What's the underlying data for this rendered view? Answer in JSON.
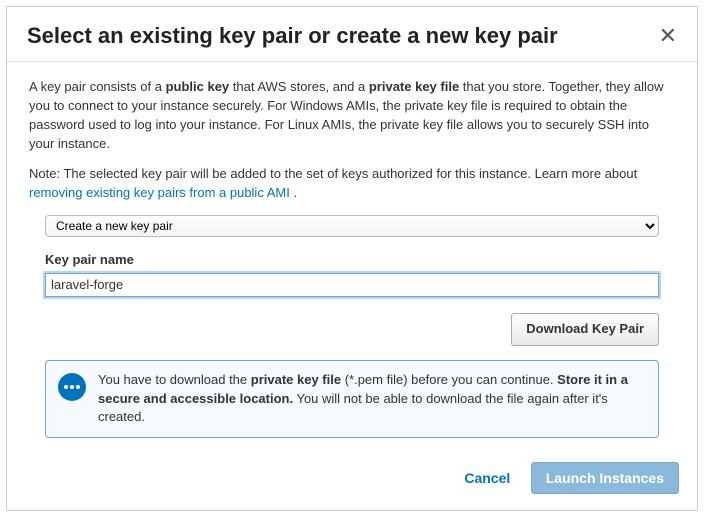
{
  "title": "Select an existing key pair or create a new key pair",
  "desc": {
    "p1a": "A key pair consists of a ",
    "p1b": "public key",
    "p1c": " that AWS stores, and a ",
    "p1d": "private key file",
    "p1e": " that you store. Together, they allow you to connect to your instance securely. For Windows AMIs, the private key file is required to obtain the password used to log into your instance. For Linux AMIs, the private key file allows you to securely SSH into your instance.",
    "p2a": "Note: The selected key pair will be added to the set of keys authorized for this instance. Learn more about ",
    "p2link": "removing existing key pairs from a public AMI",
    "p2b": " ."
  },
  "select": {
    "value": "Create a new key pair"
  },
  "keypair": {
    "label": "Key pair name",
    "value": "laravel-forge"
  },
  "download_btn": "Download Key Pair",
  "info": {
    "t1a": "You have to download the ",
    "t1b": "private key file",
    "t1c": " (*.pem file) before you can continue. ",
    "t2a": "Store it in a secure and accessible location.",
    "t2b": " You will not be able to download the file again after it's created."
  },
  "footer": {
    "cancel": "Cancel",
    "launch": "Launch Instances"
  }
}
